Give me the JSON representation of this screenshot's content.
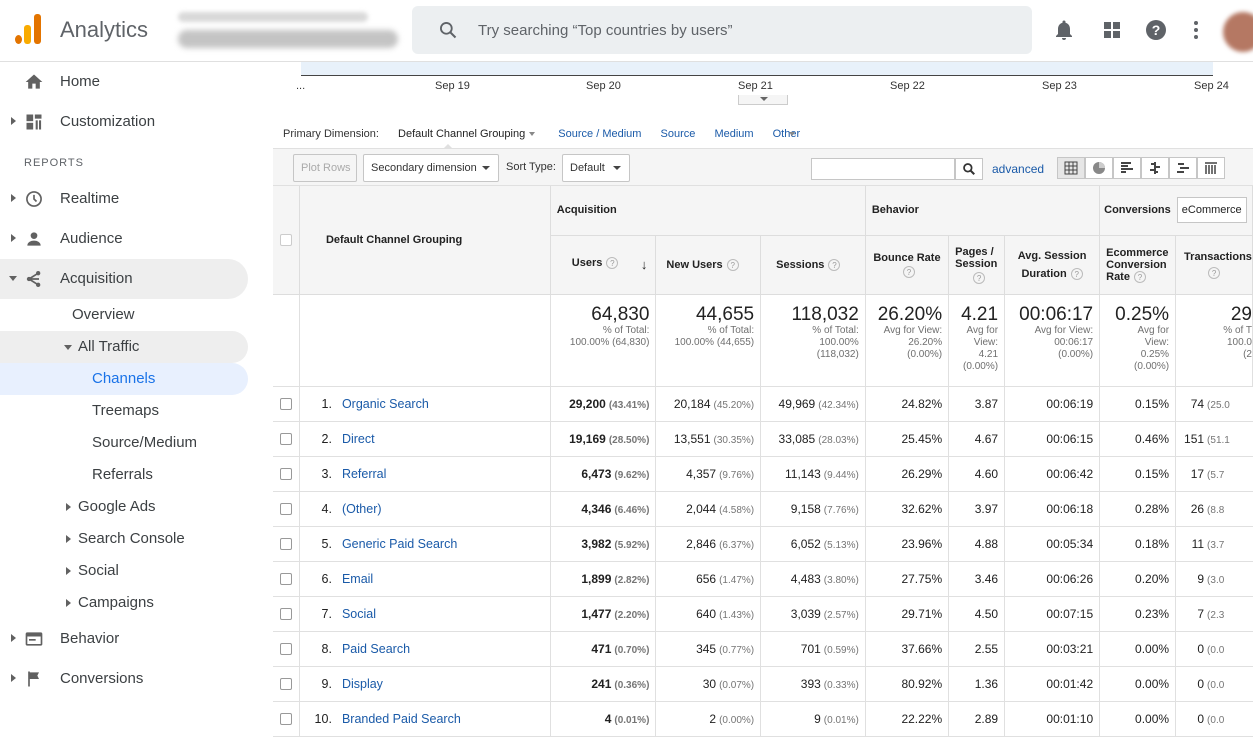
{
  "app": {
    "name": "Analytics"
  },
  "search": {
    "placeholder": "Try searching “Top countries by users”"
  },
  "icons": {
    "notifications": "bell-icon",
    "apps": "grid-icon",
    "help": "help-icon",
    "more": "more-vert-icon"
  },
  "sidebar": {
    "home": "Home",
    "customization": "Customization",
    "reports_header": "REPORTS",
    "realtime": "Realtime",
    "audience": "Audience",
    "acquisition": "Acquisition",
    "overview": "Overview",
    "all_traffic": "All Traffic",
    "channels": "Channels",
    "treemaps": "Treemaps",
    "source_medium": "Source/Medium",
    "referrals": "Referrals",
    "google_ads": "Google Ads",
    "search_console": "Search Console",
    "social": "Social",
    "campaigns": "Campaigns",
    "behavior": "Behavior",
    "conversions": "Conversions"
  },
  "chart": {
    "xlabels": [
      "...",
      "Sep 19",
      "Sep 20",
      "Sep 21",
      "Sep 22",
      "Sep 23",
      "Sep 24"
    ]
  },
  "dimension_bar": {
    "label": "Primary Dimension:",
    "selected": "Default Channel Grouping",
    "options": [
      "Source / Medium",
      "Source",
      "Medium",
      "Other"
    ]
  },
  "toolbar": {
    "plot_rows": "Plot Rows",
    "secondary_dimension": "Secondary dimension",
    "sort_type_label": "Sort Type:",
    "sort_type_value": "Default",
    "advanced": "advanced"
  },
  "table": {
    "dimension_header": "Default Channel Grouping",
    "groups": {
      "acquisition": "Acquisition",
      "behavior": "Behavior",
      "conversions": "Conversions",
      "conversions_select": "eCommerce"
    },
    "columns": {
      "users": "Users",
      "new_users": "New Users",
      "sessions": "Sessions",
      "bounce_rate": "Bounce Rate",
      "pages_session": "Pages / Session",
      "avg_session_duration": "Avg. Session Duration",
      "ecommerce_conversion_rate": "Ecommerce Conversion Rate",
      "transactions": "Transactions"
    },
    "totals": {
      "users": {
        "value": "64,830",
        "l1": "% of Total:",
        "l2": "100.00% (64,830)",
        "l3": "",
        "l4": ""
      },
      "new_users": {
        "value": "44,655",
        "l1": "% of Total:",
        "l2": "100.00% (44,655)",
        "l3": "",
        "l4": ""
      },
      "sessions": {
        "value": "118,032",
        "l1": "% of Total:",
        "l2": "100.00%",
        "l3": "(118,032)",
        "l4": ""
      },
      "bounce_rate": {
        "value": "26.20%",
        "l1": "Avg for View:",
        "l2": "26.20%",
        "l3": "(0.00%)",
        "l4": ""
      },
      "pages_session": {
        "value": "4.21",
        "l1": "Avg for",
        "l2": "View:",
        "l3": "4.21",
        "l4": "(0.00%)"
      },
      "avg_session_duration": {
        "value": "00:06:17",
        "l1": "Avg for View:",
        "l2": "00:06:17",
        "l3": "(0.00%)",
        "l4": ""
      },
      "ecommerce_conversion_rate": {
        "value": "0.25%",
        "l1": "Avg for",
        "l2": "View:",
        "l3": "0.25%",
        "l4": "(0.00%)"
      },
      "transactions": {
        "value": "29",
        "l1": "% of T",
        "l2": "100.0",
        "l3": "(2",
        "l4": ""
      }
    },
    "rows": [
      {
        "idx": "1.",
        "channel": "Organic Search",
        "users": "29,200",
        "users_pct": "(43.41%)",
        "new_users": "20,184",
        "new_users_pct": "(45.20%)",
        "sessions": "49,969",
        "sessions_pct": "(42.34%)",
        "bounce_rate": "24.82%",
        "pages_session": "3.87",
        "avg_duration": "00:06:19",
        "conv_rate": "0.15%",
        "transactions": "74",
        "transactions_pct": "(25.0"
      },
      {
        "idx": "2.",
        "channel": "Direct",
        "users": "19,169",
        "users_pct": "(28.50%)",
        "new_users": "13,551",
        "new_users_pct": "(30.35%)",
        "sessions": "33,085",
        "sessions_pct": "(28.03%)",
        "bounce_rate": "25.45%",
        "pages_session": "4.67",
        "avg_duration": "00:06:15",
        "conv_rate": "0.46%",
        "transactions": "151",
        "transactions_pct": "(51.1"
      },
      {
        "idx": "3.",
        "channel": "Referral",
        "users": "6,473",
        "users_pct": "(9.62%)",
        "new_users": "4,357",
        "new_users_pct": "(9.76%)",
        "sessions": "11,143",
        "sessions_pct": "(9.44%)",
        "bounce_rate": "26.29%",
        "pages_session": "4.60",
        "avg_duration": "00:06:42",
        "conv_rate": "0.15%",
        "transactions": "17",
        "transactions_pct": "(5.7"
      },
      {
        "idx": "4.",
        "channel": "(Other)",
        "users": "4,346",
        "users_pct": "(6.46%)",
        "new_users": "2,044",
        "new_users_pct": "(4.58%)",
        "sessions": "9,158",
        "sessions_pct": "(7.76%)",
        "bounce_rate": "32.62%",
        "pages_session": "3.97",
        "avg_duration": "00:06:18",
        "conv_rate": "0.28%",
        "transactions": "26",
        "transactions_pct": "(8.8"
      },
      {
        "idx": "5.",
        "channel": "Generic Paid Search",
        "users": "3,982",
        "users_pct": "(5.92%)",
        "new_users": "2,846",
        "new_users_pct": "(6.37%)",
        "sessions": "6,052",
        "sessions_pct": "(5.13%)",
        "bounce_rate": "23.96%",
        "pages_session": "4.88",
        "avg_duration": "00:05:34",
        "conv_rate": "0.18%",
        "transactions": "11",
        "transactions_pct": "(3.7"
      },
      {
        "idx": "6.",
        "channel": "Email",
        "users": "1,899",
        "users_pct": "(2.82%)",
        "new_users": "656",
        "new_users_pct": "(1.47%)",
        "sessions": "4,483",
        "sessions_pct": "(3.80%)",
        "bounce_rate": "27.75%",
        "pages_session": "3.46",
        "avg_duration": "00:06:26",
        "conv_rate": "0.20%",
        "transactions": "9",
        "transactions_pct": "(3.0"
      },
      {
        "idx": "7.",
        "channel": "Social",
        "users": "1,477",
        "users_pct": "(2.20%)",
        "new_users": "640",
        "new_users_pct": "(1.43%)",
        "sessions": "3,039",
        "sessions_pct": "(2.57%)",
        "bounce_rate": "29.71%",
        "pages_session": "4.50",
        "avg_duration": "00:07:15",
        "conv_rate": "0.23%",
        "transactions": "7",
        "transactions_pct": "(2.3"
      },
      {
        "idx": "8.",
        "channel": "Paid Search",
        "users": "471",
        "users_pct": "(0.70%)",
        "new_users": "345",
        "new_users_pct": "(0.77%)",
        "sessions": "701",
        "sessions_pct": "(0.59%)",
        "bounce_rate": "37.66%",
        "pages_session": "2.55",
        "avg_duration": "00:03:21",
        "conv_rate": "0.00%",
        "transactions": "0",
        "transactions_pct": "(0.0"
      },
      {
        "idx": "9.",
        "channel": "Display",
        "users": "241",
        "users_pct": "(0.36%)",
        "new_users": "30",
        "new_users_pct": "(0.07%)",
        "sessions": "393",
        "sessions_pct": "(0.33%)",
        "bounce_rate": "80.92%",
        "pages_session": "1.36",
        "avg_duration": "00:01:42",
        "conv_rate": "0.00%",
        "transactions": "0",
        "transactions_pct": "(0.0"
      },
      {
        "idx": "10.",
        "channel": "Branded Paid Search",
        "users": "4",
        "users_pct": "(0.01%)",
        "new_users": "2",
        "new_users_pct": "(0.00%)",
        "sessions": "9",
        "sessions_pct": "(0.01%)",
        "bounce_rate": "22.22%",
        "pages_session": "2.89",
        "avg_duration": "00:01:10",
        "conv_rate": "0.00%",
        "transactions": "0",
        "transactions_pct": "(0.0"
      }
    ]
  },
  "colors": {
    "accent": "#1a73e8",
    "link": "#1a5aa8",
    "logo_orange": "#e37400",
    "logo_yellow": "#f9ab00",
    "selected_bg": "#e8f0fe"
  }
}
